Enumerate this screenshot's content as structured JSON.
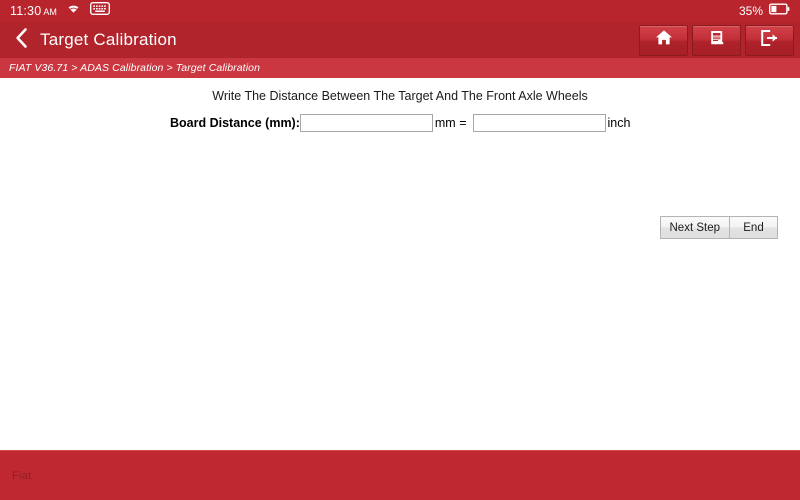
{
  "statusbar": {
    "time": "11:30",
    "ampm": "AM",
    "wifi_icon": "wifi-icon",
    "keyboard_icon": "keyboard-icon",
    "battery_percent": "35%",
    "battery_icon": "battery-icon"
  },
  "header": {
    "back_icon": "chevron-left-icon",
    "title": "Target Calibration",
    "actions": [
      {
        "name": "home-button",
        "icon": "home-icon"
      },
      {
        "name": "report-button",
        "icon": "document-report-icon"
      },
      {
        "name": "exit-button",
        "icon": "exit-arrow-icon"
      }
    ]
  },
  "breadcrumb": {
    "text": "FIAT V36.71 > ADAS Calibration > Target Calibration"
  },
  "main": {
    "instruction": "Write The Distance Between The Target And The Front Axle Wheels",
    "field_label": "Board Distance (mm):",
    "mm_value": "",
    "mm_placeholder": "",
    "unit_mm": "mm =",
    "inch_value": "",
    "inch_placeholder": "",
    "unit_inch": "inch"
  },
  "actions": {
    "next_step": "Next Step",
    "end": "End"
  },
  "footer": {
    "brand": "Fiat"
  },
  "colors": {
    "status_bar": "#b8252d",
    "header": "#b1242c",
    "breadcrumb_band": "#cb3740",
    "footer": "#bf2831",
    "content_bg": "#ffffff",
    "accent_red": "#c0272d"
  }
}
